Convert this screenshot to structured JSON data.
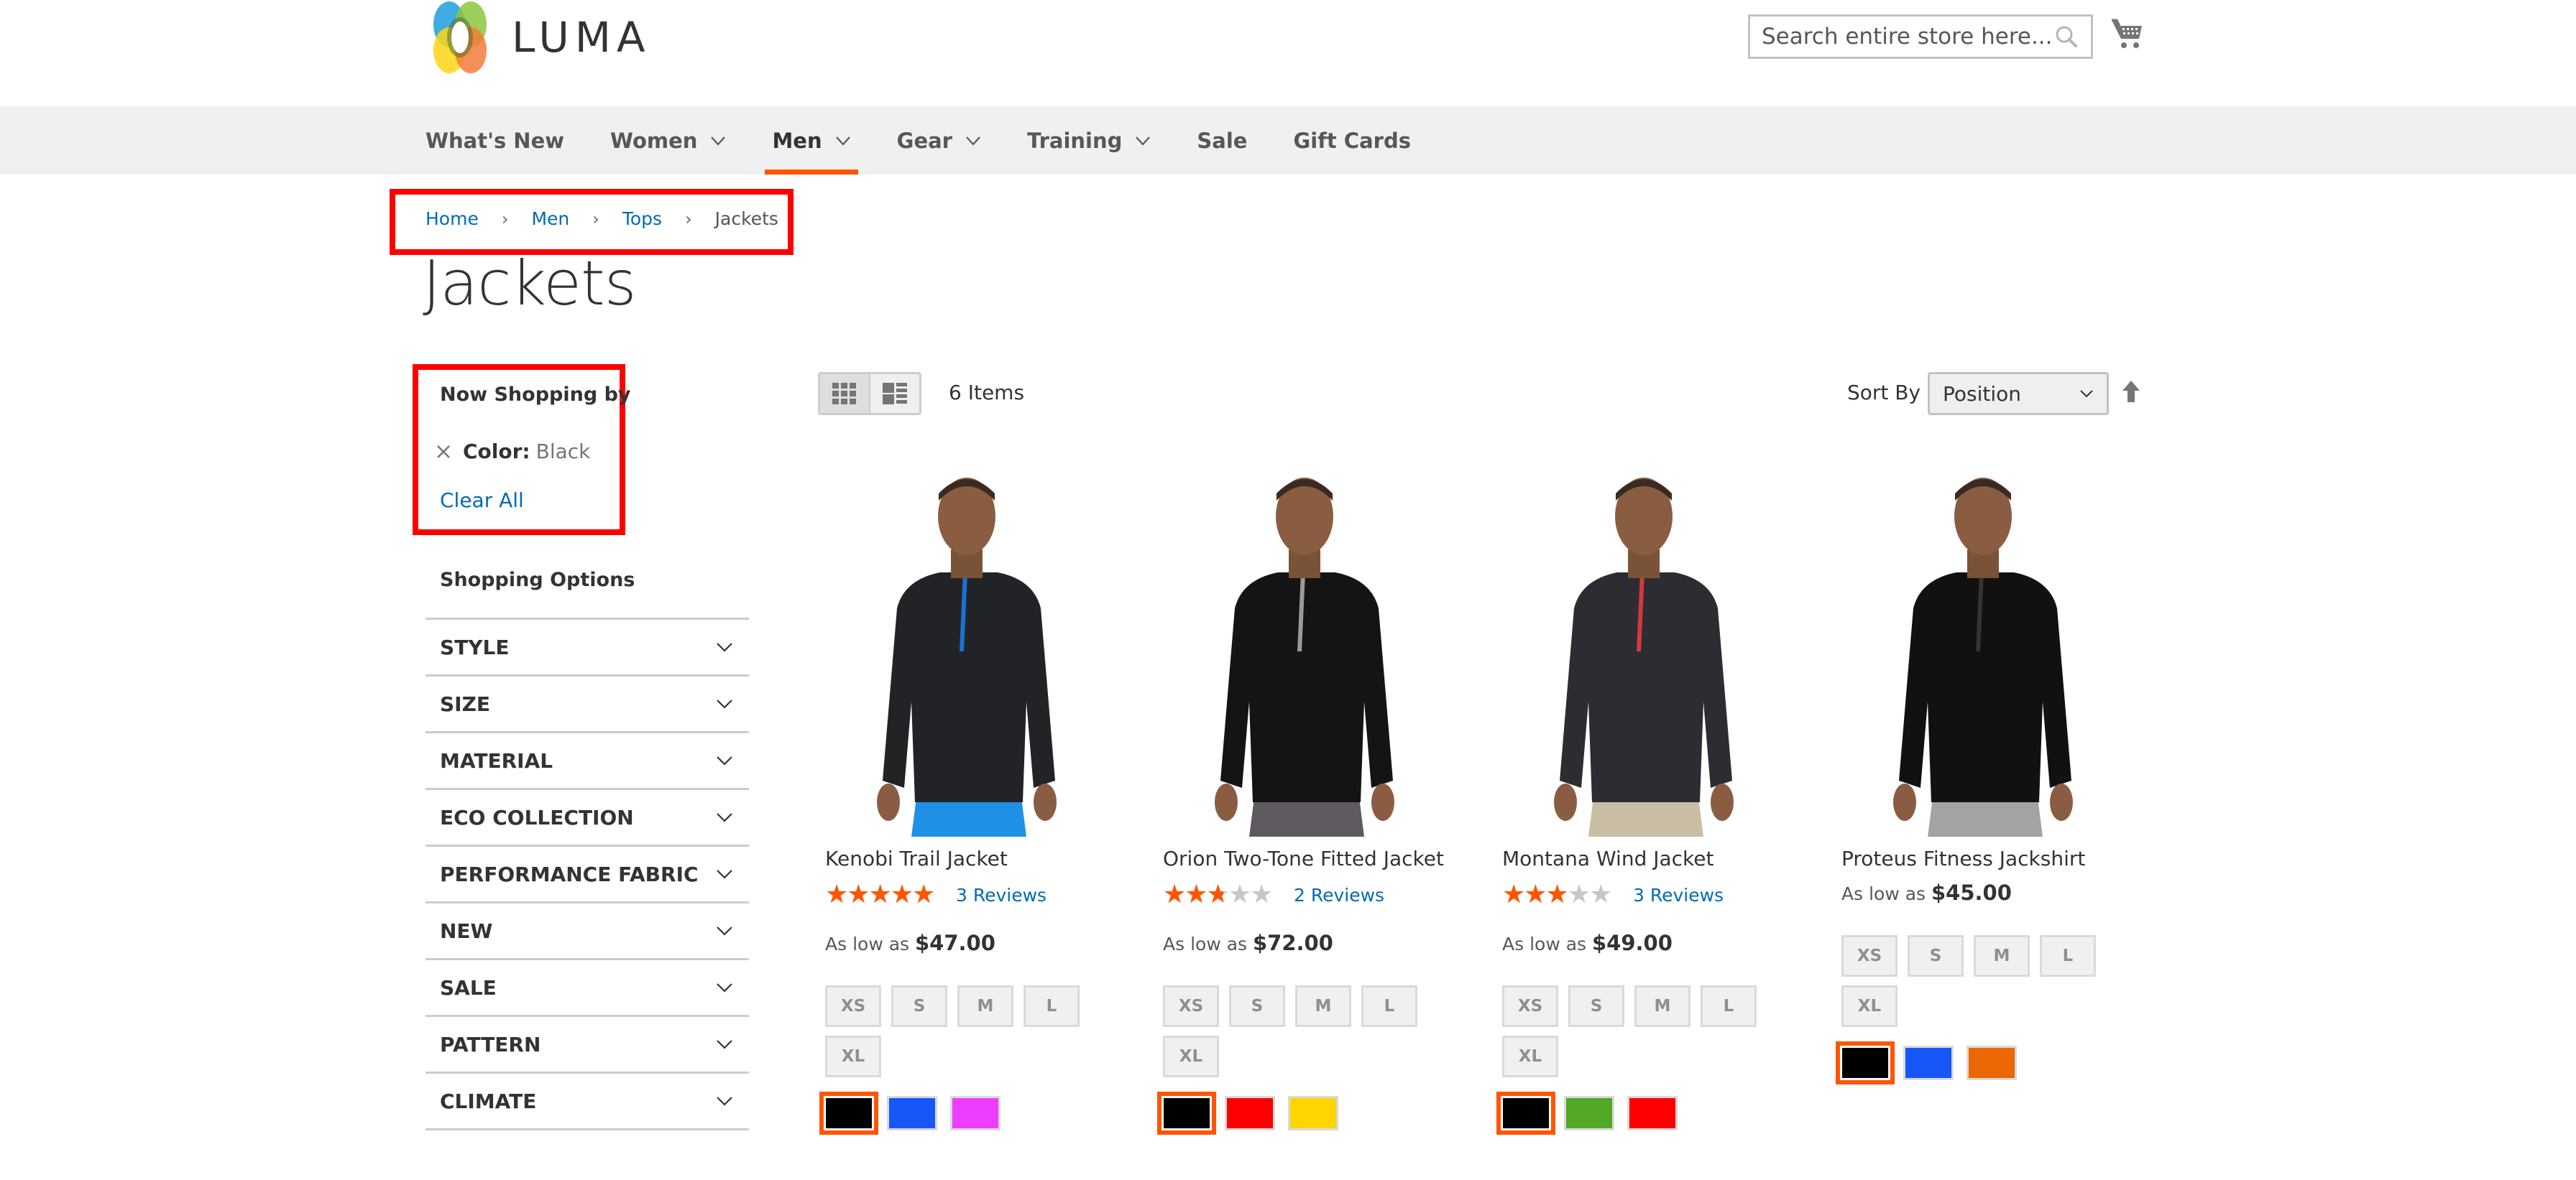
{
  "header": {
    "logo_text": "LUMA",
    "search_placeholder": "Search entire store here...",
    "cart_label": "My Cart"
  },
  "nav": {
    "items": [
      {
        "label": "What's New",
        "has_dropdown": false,
        "active": false
      },
      {
        "label": "Women",
        "has_dropdown": true,
        "active": false
      },
      {
        "label": "Men",
        "has_dropdown": true,
        "active": true
      },
      {
        "label": "Gear",
        "has_dropdown": true,
        "active": false
      },
      {
        "label": "Training",
        "has_dropdown": true,
        "active": false
      },
      {
        "label": "Sale",
        "has_dropdown": false,
        "active": false
      },
      {
        "label": "Gift Cards",
        "has_dropdown": false,
        "active": false
      }
    ],
    "accent_color": "#ff5501"
  },
  "breadcrumb": {
    "items": [
      "Home",
      "Men",
      "Tops"
    ],
    "current": "Jackets",
    "separator": "›"
  },
  "page_title": "Jackets",
  "sidebar": {
    "now_shopping_title": "Now Shopping by",
    "active_filter": {
      "label": "Color:",
      "value": "Black"
    },
    "clear_all": "Clear All",
    "options_title": "Shopping Options",
    "filters": [
      "Style",
      "Size",
      "Material",
      "Eco Collection",
      "Performance Fabric",
      "New",
      "Sale",
      "Pattern",
      "Climate"
    ]
  },
  "toolbar": {
    "view_modes": [
      "Grid",
      "List"
    ],
    "active_mode": "Grid",
    "items_count": "6 Items",
    "sort_label": "Sort By",
    "sort_value": "Position",
    "sort_direction": "ascending"
  },
  "products": [
    {
      "name": "Kenobi Trail Jacket",
      "rating_percent": 93,
      "reviews": "3  Reviews",
      "price_prefix": "As low as",
      "price": "$47.00",
      "sizes": [
        "XS",
        "S",
        "M",
        "L",
        "XL"
      ],
      "colors": [
        {
          "name": "Black",
          "hex": "#000000",
          "selected": true
        },
        {
          "name": "Blue",
          "hex": "#1857f7",
          "selected": false
        },
        {
          "name": "Purple",
          "hex": "#ef3dff",
          "selected": false
        }
      ],
      "image": {
        "top": "#222326",
        "bottom": "#1e90e6",
        "accent": "#1d6fd6"
      }
    },
    {
      "name": "Orion Two-Tone Fitted Jacket",
      "rating_percent": 50,
      "reviews": "2  Reviews",
      "price_prefix": "As low as",
      "price": "$72.00",
      "sizes": [
        "XS",
        "S",
        "M",
        "L",
        "XL"
      ],
      "colors": [
        {
          "name": "Black",
          "hex": "#000000",
          "selected": true
        },
        {
          "name": "Red",
          "hex": "#ff0000",
          "selected": false
        },
        {
          "name": "Yellow",
          "hex": "#ffd500",
          "selected": false
        }
      ],
      "image": {
        "top": "#141414",
        "bottom": "#5f5a60",
        "accent": "#9a9a9a"
      }
    },
    {
      "name": "Montana Wind Jacket",
      "rating_percent": 53,
      "reviews": "3  Reviews",
      "price_prefix": "As low as",
      "price": "$49.00",
      "sizes": [
        "XS",
        "S",
        "M",
        "L",
        "XL"
      ],
      "colors": [
        {
          "name": "Black",
          "hex": "#000000",
          "selected": true
        },
        {
          "name": "Green",
          "hex": "#53a828",
          "selected": false
        },
        {
          "name": "Red",
          "hex": "#ff0000",
          "selected": false
        }
      ],
      "image": {
        "top": "#2b2d33",
        "bottom": "#c9bda5",
        "accent": "#d23a3a"
      }
    },
    {
      "name": "Proteus Fitness Jackshirt",
      "rating_percent": null,
      "reviews": null,
      "price_prefix": "As low as",
      "price": "$45.00",
      "sizes": [
        "XS",
        "S",
        "M",
        "L",
        "XL"
      ],
      "colors": [
        {
          "name": "Black",
          "hex": "#000000",
          "selected": true
        },
        {
          "name": "Blue",
          "hex": "#1857f7",
          "selected": false
        },
        {
          "name": "Orange",
          "hex": "#eb6703",
          "selected": false
        }
      ],
      "image": {
        "top": "#111111",
        "bottom": "#a3a3a3",
        "accent": "#333333"
      }
    }
  ],
  "annotation_color": "#ff0000"
}
